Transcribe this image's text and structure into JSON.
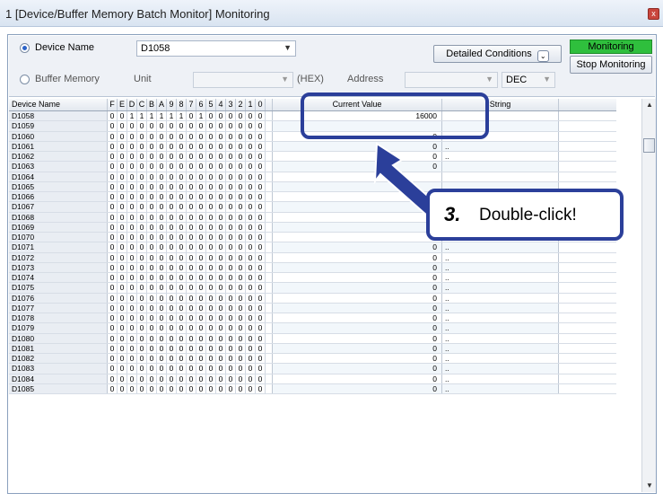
{
  "window": {
    "title": "1 [Device/Buffer Memory Batch Monitor] Monitoring",
    "close": "x"
  },
  "controls": {
    "device_name_label": "Device Name",
    "device_name_value": "D1058",
    "buffer_memory_label": "Buffer Memory",
    "unit_label": "Unit",
    "hex_label": "(HEX)",
    "address_label": "Address",
    "dec_value": "DEC",
    "detailed_conditions": "Detailed Conditions",
    "monitoring_status": "Monitoring",
    "stop_monitoring": "Stop Monitoring"
  },
  "grid": {
    "headers": {
      "device": "Device Name",
      "current": "Current Value",
      "string": "String"
    },
    "bit_headers": [
      "F",
      "E",
      "D",
      "C",
      "B",
      "A",
      "9",
      "8",
      "7",
      "6",
      "5",
      "4",
      "3",
      "2",
      "1",
      "0"
    ],
    "rows": [
      {
        "name": "D1058",
        "bits": "0011111101000000",
        "value": "16000",
        "string": ""
      },
      {
        "name": "D1059",
        "bits": "0000000000000000",
        "value": "",
        "string": ""
      },
      {
        "name": "D1060",
        "bits": "0000000000000000",
        "value": "0",
        "string": ".."
      },
      {
        "name": "D1061",
        "bits": "0000000000000000",
        "value": "0",
        "string": ".."
      },
      {
        "name": "D1062",
        "bits": "0000000000000000",
        "value": "0",
        "string": ".."
      },
      {
        "name": "D1063",
        "bits": "0000000000000000",
        "value": "0",
        "string": ""
      },
      {
        "name": "D1064",
        "bits": "0000000000000000",
        "value": "",
        "string": ""
      },
      {
        "name": "D1065",
        "bits": "0000000000000000",
        "value": "",
        "string": ""
      },
      {
        "name": "D1066",
        "bits": "0000000000000000",
        "value": "",
        "string": ""
      },
      {
        "name": "D1067",
        "bits": "0000000000000000",
        "value": "",
        "string": ""
      },
      {
        "name": "D1068",
        "bits": "0000000000000000",
        "value": "0",
        "string": ".."
      },
      {
        "name": "D1069",
        "bits": "0000000000000000",
        "value": "0",
        "string": ".."
      },
      {
        "name": "D1070",
        "bits": "0000000000000000",
        "value": "0",
        "string": ".."
      },
      {
        "name": "D1071",
        "bits": "0000000000000000",
        "value": "0",
        "string": ".."
      },
      {
        "name": "D1072",
        "bits": "0000000000000000",
        "value": "0",
        "string": ".."
      },
      {
        "name": "D1073",
        "bits": "0000000000000000",
        "value": "0",
        "string": ".."
      },
      {
        "name": "D1074",
        "bits": "0000000000000000",
        "value": "0",
        "string": ".."
      },
      {
        "name": "D1075",
        "bits": "0000000000000000",
        "value": "0",
        "string": ".."
      },
      {
        "name": "D1076",
        "bits": "0000000000000000",
        "value": "0",
        "string": ".."
      },
      {
        "name": "D1077",
        "bits": "0000000000000000",
        "value": "0",
        "string": ".."
      },
      {
        "name": "D1078",
        "bits": "0000000000000000",
        "value": "0",
        "string": ".."
      },
      {
        "name": "D1079",
        "bits": "0000000000000000",
        "value": "0",
        "string": ".."
      },
      {
        "name": "D1080",
        "bits": "0000000000000000",
        "value": "0",
        "string": ".."
      },
      {
        "name": "D1081",
        "bits": "0000000000000000",
        "value": "0",
        "string": ".."
      },
      {
        "name": "D1082",
        "bits": "0000000000000000",
        "value": "0",
        "string": ".."
      },
      {
        "name": "D1083",
        "bits": "0000000000000000",
        "value": "0",
        "string": ".."
      },
      {
        "name": "D1084",
        "bits": "0000000000000000",
        "value": "0",
        "string": ".."
      },
      {
        "name": "D1085",
        "bits": "0000000000000000",
        "value": "0",
        "string": ".."
      }
    ]
  },
  "annotation": {
    "step": "3.",
    "text": "Double-click!"
  },
  "colors": {
    "accent": "#2b3f9a",
    "status_green": "#2fbf3d"
  }
}
